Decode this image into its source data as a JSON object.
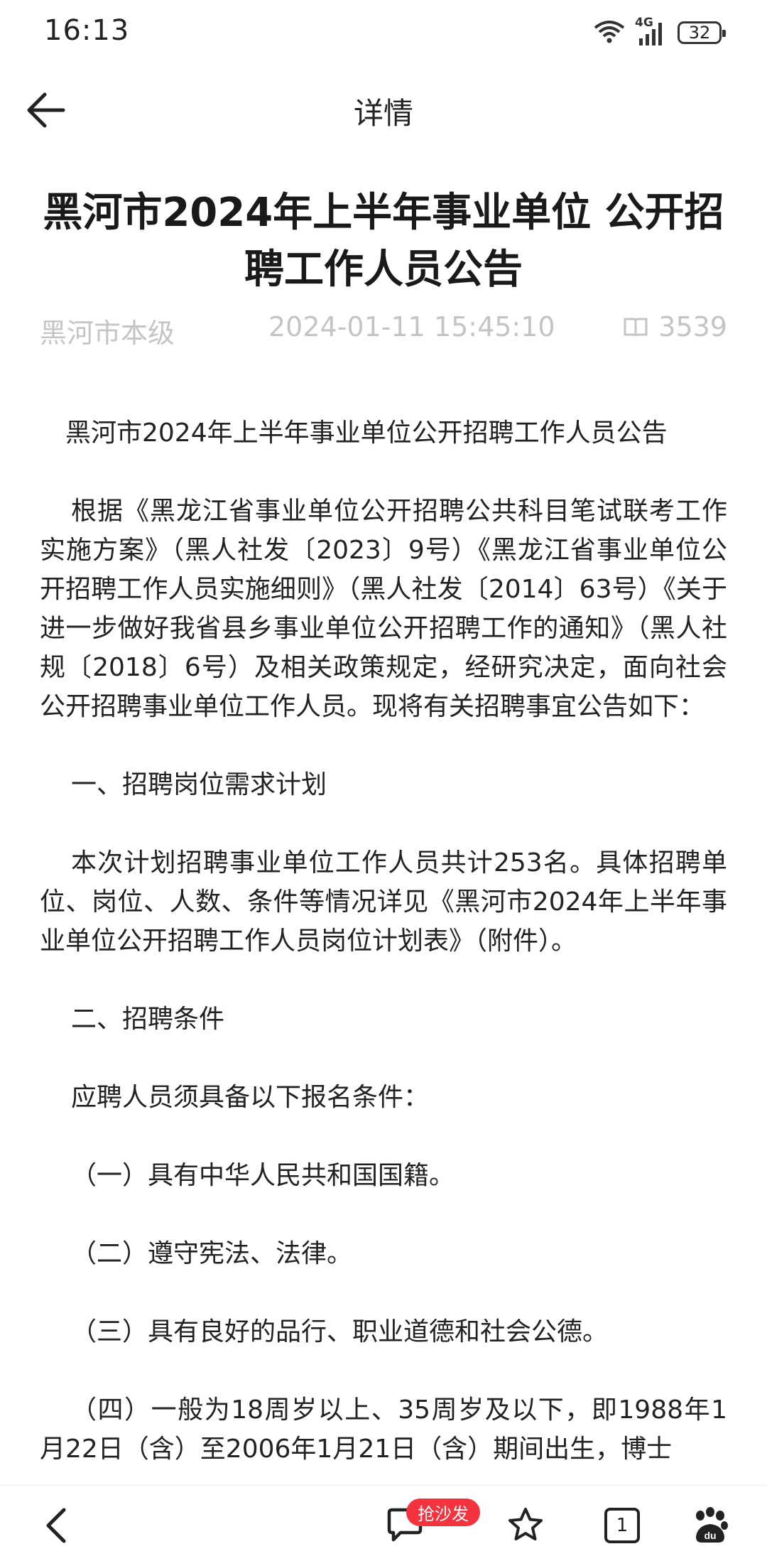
{
  "status_bar": {
    "time": "16:13",
    "network": "4G",
    "battery": "32"
  },
  "header": {
    "title": "详情"
  },
  "article": {
    "title": "黑河市2024年上半年事业单位 公开招聘工作人员公告",
    "source": "黑河市本级",
    "published": "2024-01-11 15:45:10",
    "views": "3539",
    "paragraphs": [
      "黑河市2024年上半年事业单位公开招聘工作人员公告",
      "根据《黑龙江省事业单位公开招聘公共科目笔试联考工作实施方案》（黑人社发〔2023〕9号）《黑龙江省事业单位公开招聘工作人员实施细则》（黑人社发〔2014〕63号）《关于进一步做好我省县乡事业单位公开招聘工作的通知》（黑人社规〔2018〕6号）及相关政策规定，经研究决定，面向社会公开招聘事业单位工作人员。现将有关招聘事宜公告如下：",
      "一、招聘岗位需求计划",
      "本次计划招聘事业单位工作人员共计253名。具体招聘单位、岗位、人数、条件等情况详见《黑河市2024年上半年事业单位公开招聘工作人员岗位计划表》（附件）。",
      "二、招聘条件",
      "应聘人员须具备以下报名条件：",
      "（一）具有中华人民共和国国籍。",
      "（二）遵守宪法、法律。",
      "（三）具有良好的品行、职业道德和社会公德。",
      "（四）一般为18周岁以上、35周岁及以下，即1988年1月22日（含）至2006年1月21日（含）期间出生，博士"
    ]
  },
  "toolbar": {
    "sofa_badge": "抢沙发",
    "tab_count": "1"
  },
  "colors": {
    "meta_gray": "#c4c4c4",
    "badge_red": "#f5333f",
    "text": "#222222"
  }
}
